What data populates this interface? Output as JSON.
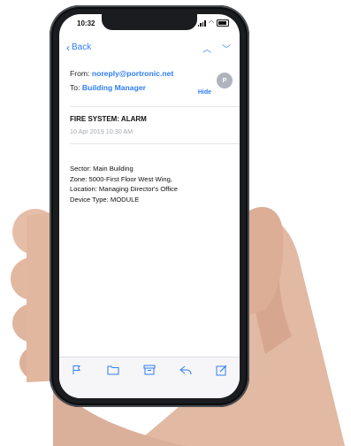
{
  "status": {
    "time": "10:32"
  },
  "nav": {
    "back_label": "Back"
  },
  "email": {
    "from_label": "From:",
    "from_address": "noreply@portronic.net",
    "to_label": "To:",
    "to_name": "Building Manager",
    "hide_label": "Hide",
    "avatar_initial": "P",
    "subject": "FIRE SYSTEM: ALARM",
    "date": "10 Apr 2019 10:30 AM",
    "body_lines": [
      "Sector: Main Building",
      "Zone: 5000-First Floor West Wing,",
      "Location: Managing Director's Office",
      "Device Type: MODULE"
    ]
  },
  "toolbar": {
    "icons": [
      "flag-icon",
      "folder-icon",
      "archive-icon",
      "reply-icon",
      "compose-icon"
    ]
  },
  "colors": {
    "accent": "#2f7ef5",
    "toolbar_bg": "#f6f6f8"
  }
}
